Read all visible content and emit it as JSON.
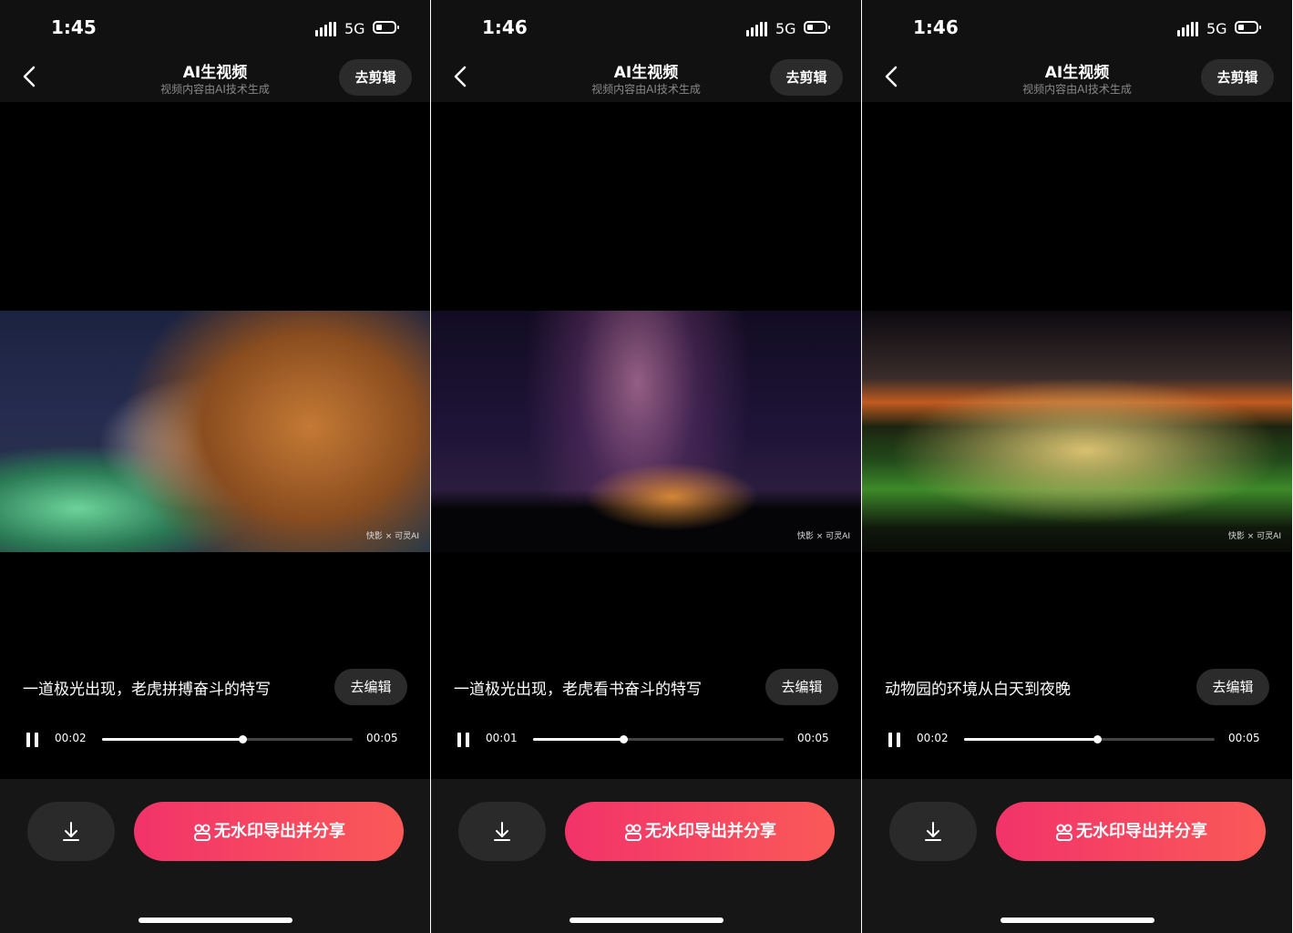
{
  "status_bar": {
    "network": "5G"
  },
  "screens": [
    {
      "time": "1:45",
      "nav": {
        "title": "AI生视频",
        "subtitle": "视频内容由AI技术生成",
        "edit_label": "去剪辑"
      },
      "video": {
        "scene": "tiger-aurora",
        "watermark": "快影 × 可灵AI"
      },
      "caption": "一道极光出现，老虎拼搏奋斗的特写",
      "caption_edit_label": "去编辑",
      "player": {
        "current_time": "00:02",
        "duration": "00:05",
        "progress": 0.56
      },
      "actions": {
        "export_label": "无水印导出并分享"
      }
    },
    {
      "time": "1:46",
      "nav": {
        "title": "AI生视频",
        "subtitle": "视频内容由AI技术生成",
        "edit_label": "去剪辑"
      },
      "video": {
        "scene": "tiger-milky-way-reading",
        "watermark": "快影 × 可灵AI"
      },
      "caption": "一道极光出现，老虎看书奋斗的特写",
      "caption_edit_label": "去编辑",
      "player": {
        "current_time": "00:01",
        "duration": "00:05",
        "progress": 0.36
      },
      "actions": {
        "export_label": "无水印导出并分享"
      }
    },
    {
      "time": "1:46",
      "nav": {
        "title": "AI生视频",
        "subtitle": "视频内容由AI技术生成",
        "edit_label": "去剪辑"
      },
      "video": {
        "scene": "zoo-night",
        "watermark": "快影 × 可灵AI"
      },
      "caption": "动物园的环境从白天到夜晚",
      "caption_edit_label": "去编辑",
      "player": {
        "current_time": "00:02",
        "duration": "00:05",
        "progress": 0.53
      },
      "actions": {
        "export_label": "无水印导出并分享"
      }
    }
  ],
  "colors": {
    "accent_start": "#f2336a",
    "accent_end": "#fa5958",
    "background": "#000000",
    "button_dark": "#2b2b2b"
  },
  "icons": {
    "back": "chevron-left-icon",
    "pause": "pause-icon",
    "download": "download-icon",
    "export": "share-people-icon"
  }
}
